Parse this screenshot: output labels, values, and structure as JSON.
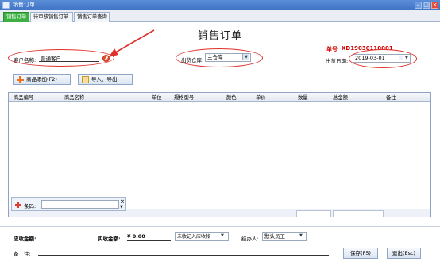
{
  "window": {
    "title": "销售订单",
    "min": "–",
    "max": "□",
    "close": "×"
  },
  "tabs": [
    {
      "label": "销售订单"
    },
    {
      "label": "待审核销售订单"
    },
    {
      "label": "销售订单查询"
    }
  ],
  "header": {
    "page_title": "销售订单",
    "order_no_label": "单号",
    "order_no_value": "XD19030110001",
    "customer_label": "客户名称:",
    "customer_value": "普通客户",
    "warehouse_label": "出货仓库:",
    "warehouse_value": "主仓库",
    "date_label": "出货日期:",
    "date_value": "2019-03-01"
  },
  "toolbar": {
    "add_product": "商品添加(F2)",
    "import_export": "导入、导出"
  },
  "grid": {
    "columns": [
      "商品编号",
      "商品名称",
      "单位",
      "规格型号",
      "颜色",
      "单价",
      "数量",
      "总金额",
      "备注"
    ]
  },
  "barcode": {
    "label": "条码:",
    "clear": "×",
    "drop": "▼"
  },
  "footer": {
    "receivable_label": "应收金额:",
    "received_label": "实收金额:",
    "received_value": "¥ 0.00",
    "settle_value": "未收记入应收帐",
    "handler_label": "经办人:",
    "handler_value": "默认员工",
    "remark_label": "备　注:",
    "save_button": "保存(F5)",
    "exit_button": "退出(Esc)"
  },
  "colors": {
    "accent": "#3cb043",
    "order_no": "#d60000",
    "annotation": "#e0302a"
  },
  "icons": [
    "app-icon",
    "customer-picker-icon",
    "calendar-icon",
    "add-icon",
    "import-icon",
    "barcode-icon"
  ]
}
